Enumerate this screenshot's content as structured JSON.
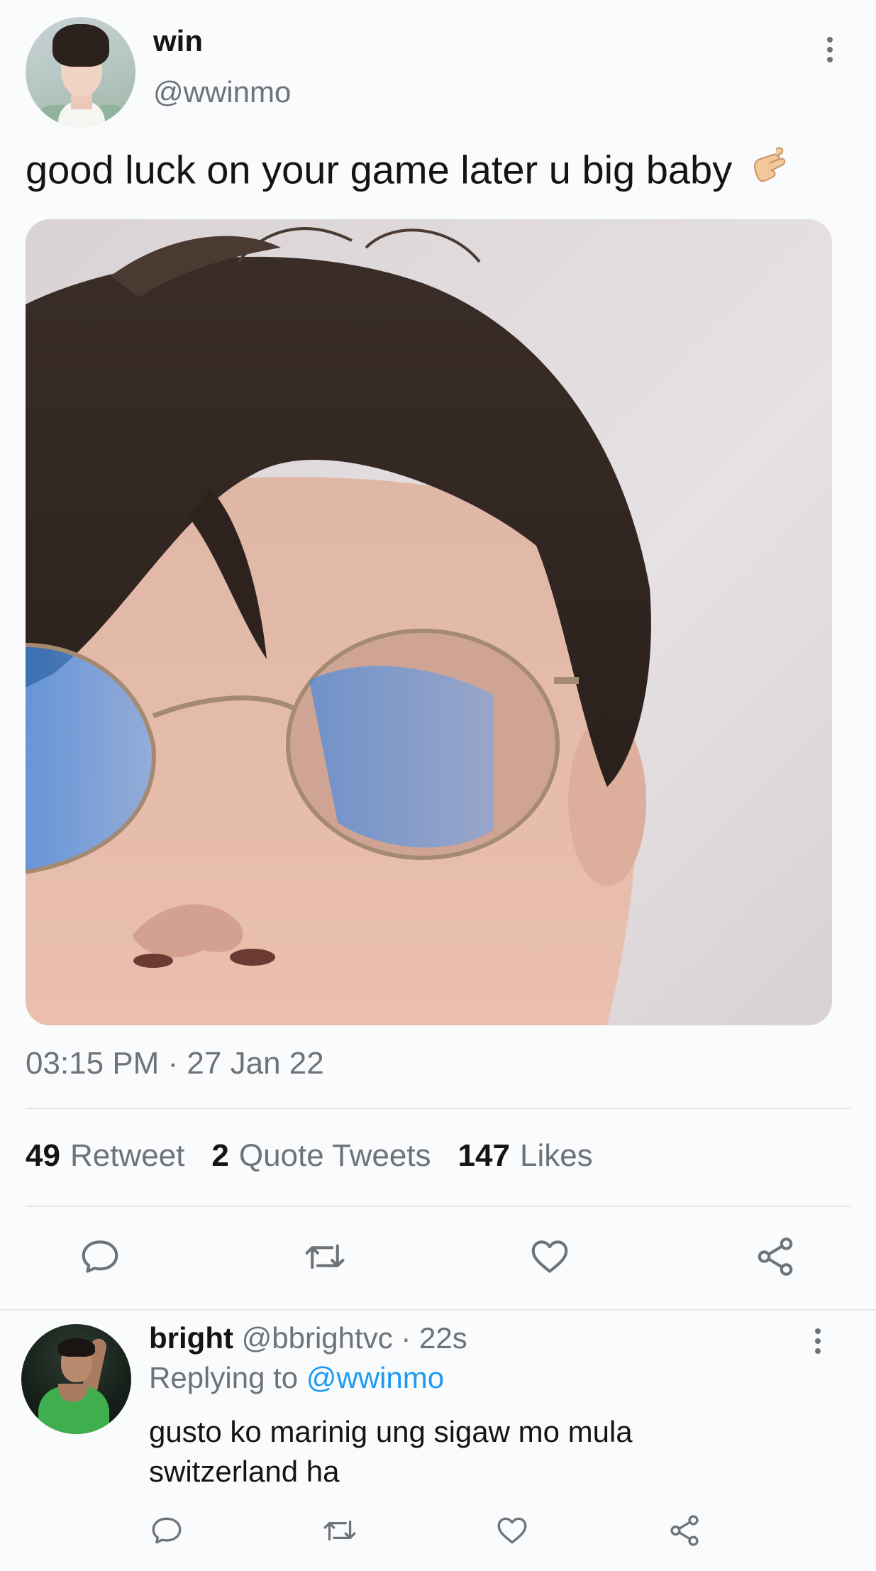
{
  "tweet": {
    "author": {
      "name": "win",
      "handle": "@wwinmo"
    },
    "text": "good luck on your game later u big baby",
    "emoji_icon": "pinching-hand-icon",
    "timestamp": "03:15 PM · 27 Jan 22",
    "stats": {
      "retweets_count": "49",
      "retweets_label": "Retweet",
      "quotes_count": "2",
      "quotes_label": "Quote Tweets",
      "likes_count": "147",
      "likes_label": "Likes"
    },
    "actions": [
      "reply-icon",
      "retweet-icon",
      "like-icon",
      "share-icon"
    ]
  },
  "reply": {
    "author": {
      "name": "bright",
      "handle": "@bbrightvc"
    },
    "time": "22s",
    "replying_label": "Replying to",
    "replying_to": "@wwinmo",
    "text": "gusto ko marinig ung sigaw mo mula switzerland ha"
  },
  "colors": {
    "link": "#1d9bf0",
    "secondary_text": "#6e7378",
    "primary_text": "#141414",
    "divider": "#e3e6e8"
  }
}
